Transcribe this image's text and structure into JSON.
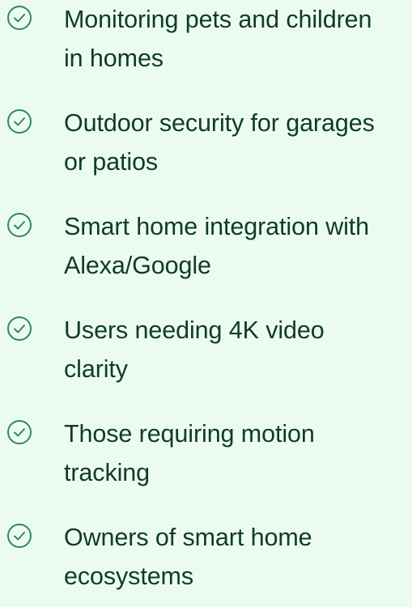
{
  "colors": {
    "background": "#ecfbf2",
    "text": "#0f3b2a",
    "check": "#2f8a55"
  },
  "list": {
    "icon": "check-circle-icon",
    "items": [
      {
        "line1": "Monitoring pets and children",
        "line2": "in homes"
      },
      {
        "line1": "Outdoor security for garages",
        "line2": "or patios"
      },
      {
        "line1": "Smart home integration with",
        "line2": "Alexa/Google"
      },
      {
        "line1": "Users needing 4K video",
        "line2": "clarity"
      },
      {
        "line1": "Those requiring motion",
        "line2": "tracking"
      },
      {
        "line1": "Owners of smart home",
        "line2": "ecosystems"
      }
    ]
  }
}
